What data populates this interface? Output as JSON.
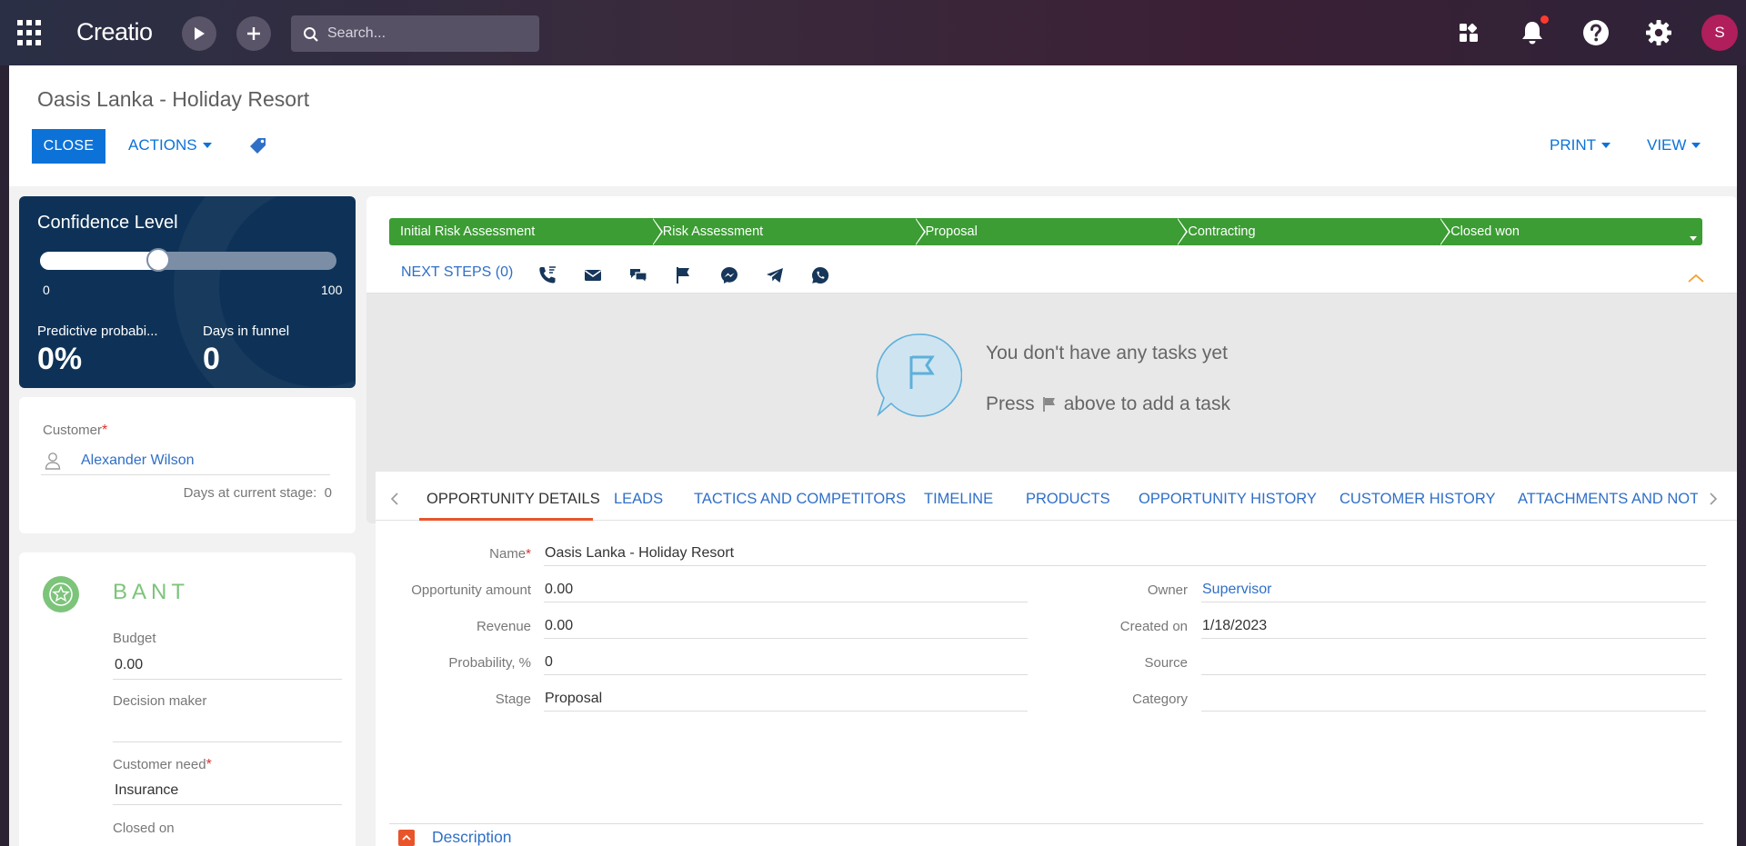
{
  "topbar": {
    "logo": "Creatio",
    "search_placeholder": "Search...",
    "user_initial": "S"
  },
  "page": {
    "title": "Oasis Lanka - Holiday Resort",
    "close_label": "CLOSE",
    "actions_label": "ACTIONS",
    "print_label": "PRINT",
    "view_label": "VIEW"
  },
  "confidence": {
    "title": "Confidence Level",
    "slider_min": "0",
    "slider_max": "100",
    "slider_fraction": 0.4,
    "predictive_label": "Predictive probabi...",
    "predictive_value": "0%",
    "days_label": "Days in funnel",
    "days_value": "0"
  },
  "customer": {
    "label": "Customer",
    "required_mark": "*",
    "value": "Alexander Wilson",
    "days_stage_label": "Days at current stage:",
    "days_stage_value": "0"
  },
  "bant": {
    "title": "BANT",
    "budget_label": "Budget",
    "budget_value": "0.00",
    "decision_label": "Decision maker",
    "decision_value": "",
    "need_label": "Customer need",
    "need_required": "*",
    "need_value": "Insurance",
    "closed_label": "Closed on"
  },
  "process": {
    "stages": [
      "Initial Risk Assessment",
      "Risk Assessment",
      "Proposal",
      "Contracting",
      "Closed won"
    ],
    "color": "#3b9d33"
  },
  "next_steps": {
    "label": "NEXT STEPS (0)",
    "empty_title": "You don't have any tasks yet",
    "empty_press": "Press",
    "empty_rest": "above to add a task"
  },
  "tabs": [
    "OPPORTUNITY DETAILS",
    "LEADS",
    "TACTICS AND COMPETITORS",
    "TIMELINE",
    "PRODUCTS",
    "OPPORTUNITY HISTORY",
    "CUSTOMER HISTORY",
    "ATTACHMENTS AND NOTI"
  ],
  "details": {
    "name_label": "Name",
    "name_required": "*",
    "name_value": "Oasis Lanka - Holiday Resort",
    "amount_label": "Opportunity amount",
    "amount_value": "0.00",
    "revenue_label": "Revenue",
    "revenue_value": "0.00",
    "probability_label": "Probability, %",
    "probability_value": "0",
    "stage_label": "Stage",
    "stage_value": "Proposal",
    "owner_label": "Owner",
    "owner_value": "Supervisor",
    "created_label": "Created on",
    "created_value": "1/18/2023",
    "source_label": "Source",
    "source_value": "",
    "category_label": "Category",
    "category_value": "",
    "description_label": "Description"
  },
  "colors": {
    "accent": "#0c72d8",
    "link": "#2f6fc7",
    "confidence_bg": "#0e3257",
    "tab_underline": "#e8552a",
    "bant_green": "#7cc47a"
  }
}
